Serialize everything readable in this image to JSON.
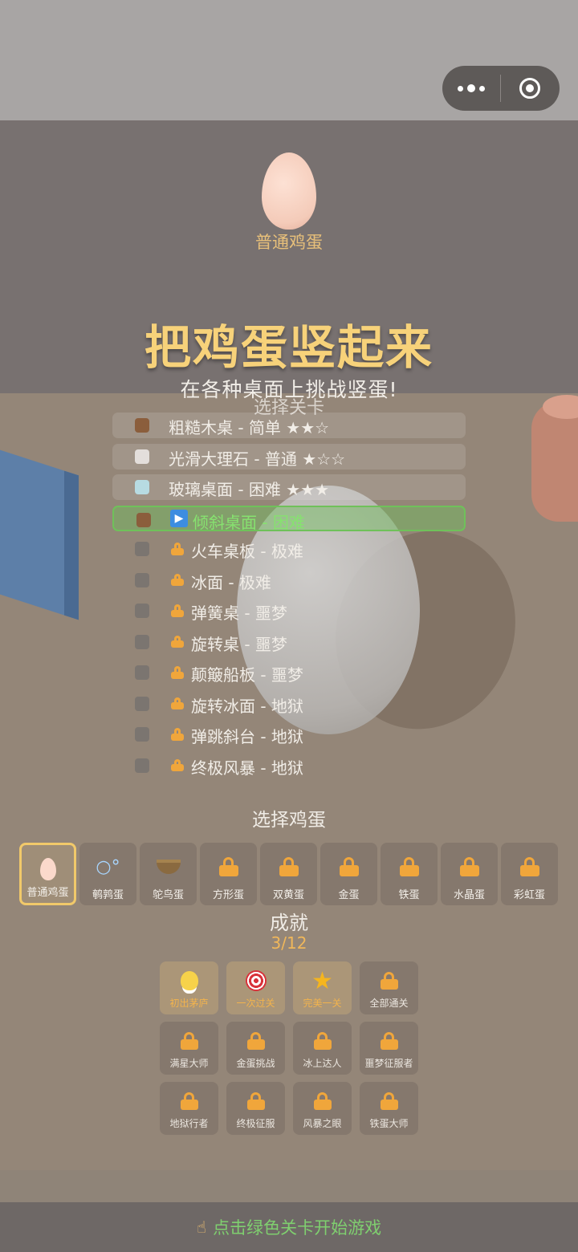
{
  "nav": {
    "more_icon": "more-dots-icon",
    "close_icon": "circle-close-icon"
  },
  "selected_egg": {
    "name": "普通鸡蛋"
  },
  "title": "把鸡蛋竖起来",
  "subtitle": "在各种桌面上挑战竖蛋!",
  "levels_heading": "选择关卡",
  "levels": [
    {
      "label": "粗糙木桌 - 简单 ★★☆",
      "color": "#8b5e3c",
      "state": "open"
    },
    {
      "label": "光滑大理石 - 普通 ★☆☆",
      "color": "#e3dedb",
      "state": "open"
    },
    {
      "label": "玻璃桌面 - 困难 ★★★",
      "color": "#b7dbe2",
      "state": "open"
    },
    {
      "label": "倾斜桌面 - 困难",
      "color": "#8b5e3c",
      "state": "current"
    },
    {
      "label": "火车桌板 - 极难",
      "color": "#7b7570",
      "state": "locked"
    },
    {
      "label": "冰面 - 极难",
      "color": "#7b7570",
      "state": "locked"
    },
    {
      "label": "弹簧桌 - 噩梦",
      "color": "#7b7570",
      "state": "locked"
    },
    {
      "label": "旋转桌 - 噩梦",
      "color": "#7b7570",
      "state": "locked"
    },
    {
      "label": "颠簸船板 - 噩梦",
      "color": "#7b7570",
      "state": "locked"
    },
    {
      "label": "旋转冰面 - 地狱",
      "color": "#7b7570",
      "state": "locked"
    },
    {
      "label": "弹跳斜台 - 地狱",
      "color": "#7b7570",
      "state": "locked"
    },
    {
      "label": "终极风暴 - 地狱",
      "color": "#7b7570",
      "state": "locked"
    }
  ],
  "eggs_heading": "选择鸡蛋",
  "eggs": [
    {
      "name": "普通鸡蛋",
      "icon": "egg-icon",
      "selected": true,
      "locked": false
    },
    {
      "name": "鹌鹑蛋",
      "icon": "bubbles-icon",
      "selected": false,
      "locked": false
    },
    {
      "name": "鸵鸟蛋",
      "icon": "nest-icon",
      "selected": false,
      "locked": false
    },
    {
      "name": "方形蛋",
      "icon": "lock-icon",
      "selected": false,
      "locked": true
    },
    {
      "name": "双黄蛋",
      "icon": "lock-icon",
      "selected": false,
      "locked": true
    },
    {
      "name": "金蛋",
      "icon": "lock-icon",
      "selected": false,
      "locked": true
    },
    {
      "name": "铁蛋",
      "icon": "lock-icon",
      "selected": false,
      "locked": true
    },
    {
      "name": "水晶蛋",
      "icon": "lock-icon",
      "selected": false,
      "locked": true
    },
    {
      "name": "彩虹蛋",
      "icon": "lock-icon",
      "selected": false,
      "locked": true
    }
  ],
  "achievements_heading": "成就",
  "achievements_count": "3/12",
  "achievements": [
    {
      "name": "初出茅庐",
      "icon": "chick-icon",
      "done": true
    },
    {
      "name": "一次过关",
      "icon": "target-icon",
      "done": true
    },
    {
      "name": "完美一关",
      "icon": "star-icon",
      "done": true
    },
    {
      "name": "全部通关",
      "icon": "lock-icon",
      "done": false
    },
    {
      "name": "满星大师",
      "icon": "lock-icon",
      "done": false
    },
    {
      "name": "金蛋挑战",
      "icon": "lock-icon",
      "done": false
    },
    {
      "name": "冰上达人",
      "icon": "lock-icon",
      "done": false
    },
    {
      "name": "噩梦征服者",
      "icon": "lock-icon",
      "done": false
    },
    {
      "name": "地狱行者",
      "icon": "lock-icon",
      "done": false
    },
    {
      "name": "终极征服",
      "icon": "lock-icon",
      "done": false
    },
    {
      "name": "风暴之眼",
      "icon": "lock-icon",
      "done": false
    },
    {
      "name": "铁蛋大师",
      "icon": "lock-icon",
      "done": false
    }
  ],
  "footer_hint": "点击绿色关卡开始游戏",
  "colors": {
    "title": "#f7d27a",
    "current_level": "#86e26f",
    "lock": "#f0a63b",
    "hint": "#7fcf6f"
  }
}
